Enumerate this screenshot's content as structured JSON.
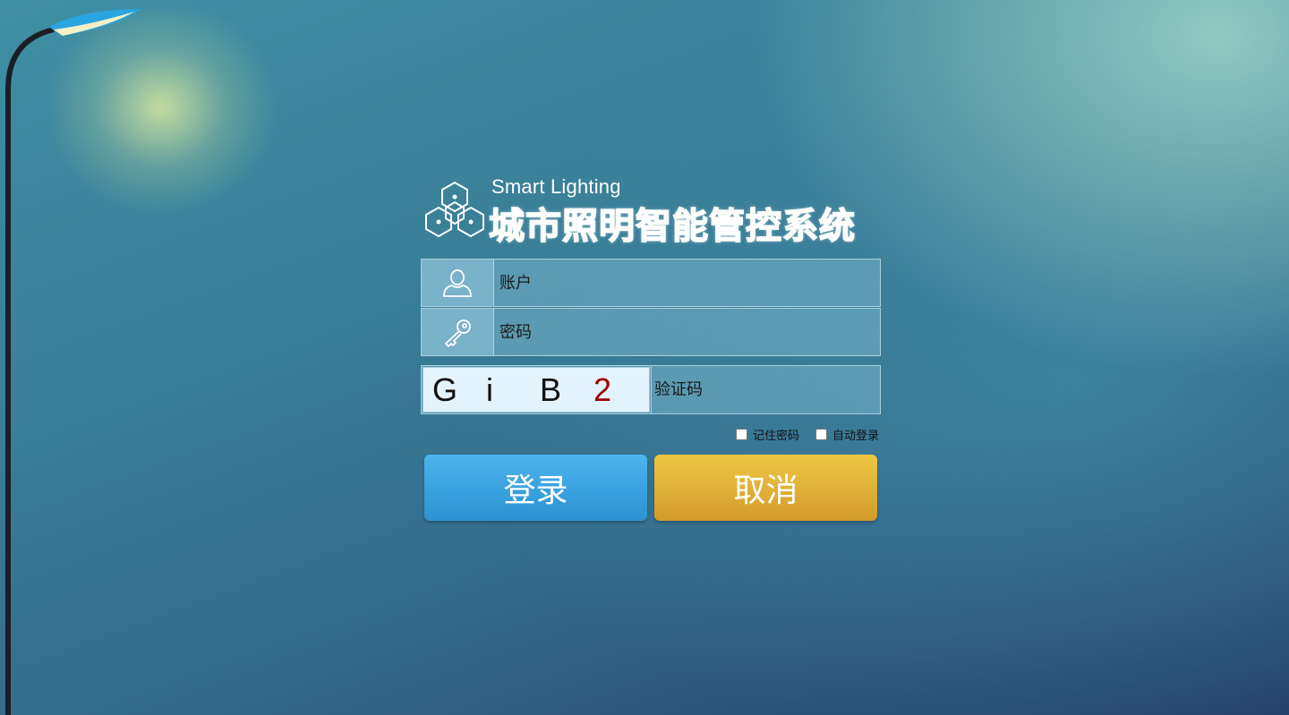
{
  "logo": {
    "subtitle": "Smart Lighting",
    "title": "城市照明智能管控系统",
    "icon": "hexagon-cubes-icon"
  },
  "form": {
    "account": {
      "icon": "user-icon",
      "placeholder": "账户"
    },
    "password": {
      "icon": "key-icon",
      "placeholder": "密码"
    },
    "captcha": {
      "chars": [
        "G",
        "i",
        "B",
        "2"
      ],
      "char_colors": [
        "#111111",
        "#111111",
        "#111111",
        "#a00000"
      ],
      "placeholder": "验证码"
    }
  },
  "options": {
    "remember_password": "记住密码",
    "auto_login": "自动登录"
  },
  "buttons": {
    "login": "登录",
    "cancel": "取消"
  },
  "colors": {
    "login_button": "#3aa3e0",
    "cancel_button": "#e1b23a",
    "lamp_shade": "#2aa5e0"
  }
}
